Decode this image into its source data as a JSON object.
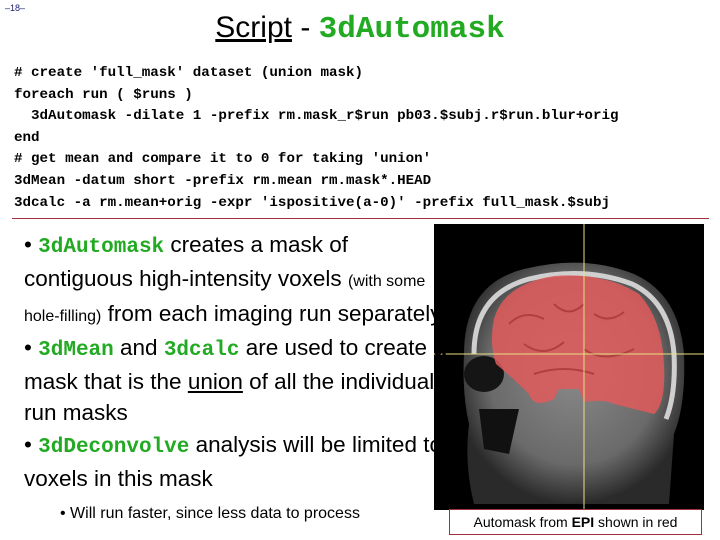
{
  "page_number": "–18–",
  "title": {
    "part1": "Script",
    "separator": " - ",
    "part2": "3dAutomask"
  },
  "code_lines": [
    "# create 'full_mask' dataset (union mask)",
    "foreach run ( $runs )",
    "  3dAutomask -dilate 1 -prefix rm.mask_r$run pb03.$subj.r$run.blur+orig",
    "end",
    "# get mean and compare it to 0 for taking 'union'",
    "3dMean -datum short -prefix rm.mean rm.mask*.HEAD",
    "3dcalc -a rm.mean+orig -expr 'ispositive(a-0)' -prefix full_mask.$subj"
  ],
  "bullets": {
    "b1_cmd": "3dAutomask",
    "b1_text1": " creates a mask of contiguous high-intensity voxels ",
    "b1_small": "(with some hole-filling)",
    "b1_text2": " from each imaging run separately",
    "b2_cmd1": "3dMean",
    "b2_and": " and ",
    "b2_cmd2": "3dcalc",
    "b2_text1": " are used to create a mask that is the ",
    "b2_underline": "union",
    "b2_text2": " of all the individual run masks",
    "b3_cmd": "3dDeconvolve",
    "b3_text": " analysis will be limited to voxels in this mask",
    "sub_bullet": "• Will run faster, since less data to process"
  },
  "figure": {
    "alt": "Sagittal brain MRI with red automask overlay and yellow crosshair",
    "caption_pre": "Automask from ",
    "caption_bold": "EPI",
    "caption_post": " shown in red",
    "mask_color": "#e05a5a",
    "crosshair_color": "#e8e080"
  },
  "colors": {
    "command_green": "#22aa22",
    "rule_red": "#a0303c"
  }
}
